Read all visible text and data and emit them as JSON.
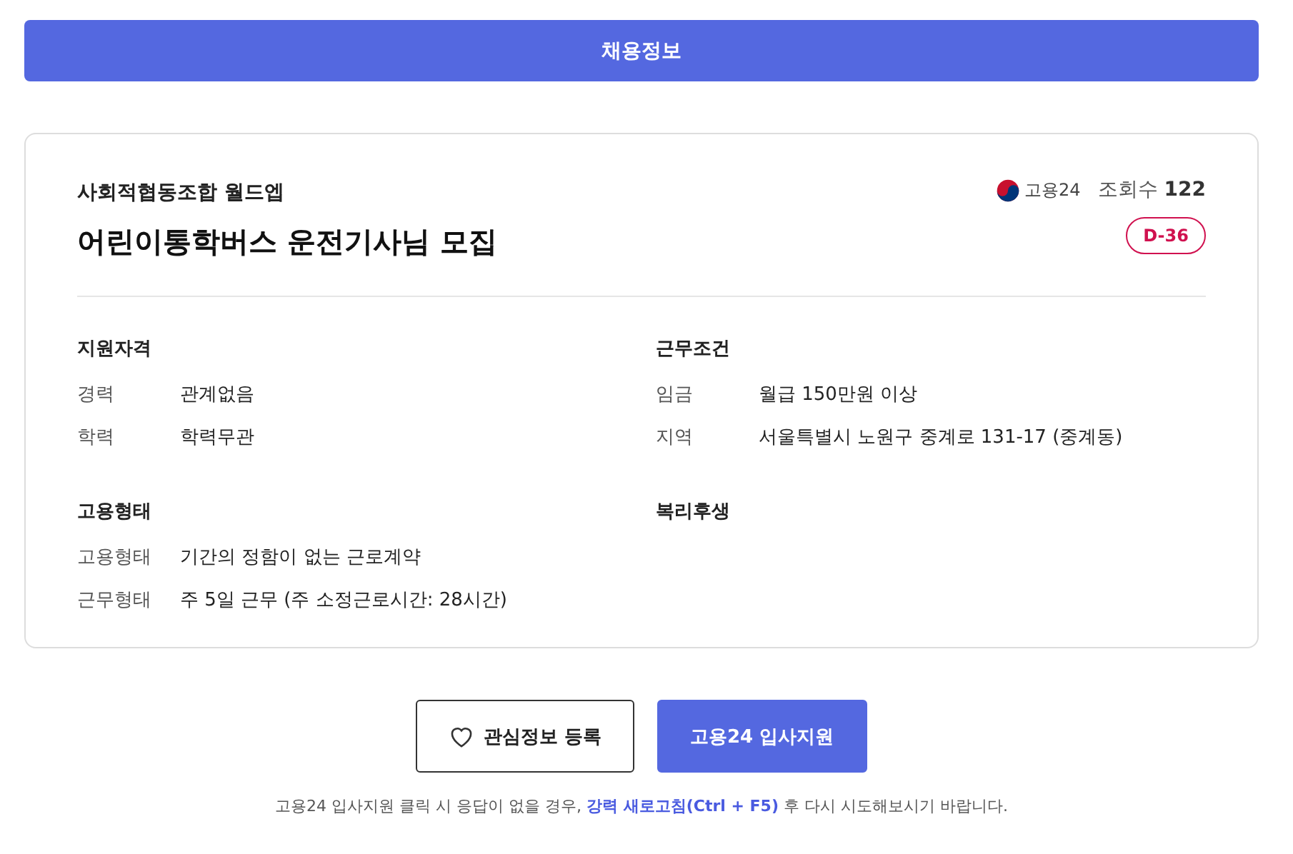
{
  "header": {
    "title": "채용정보"
  },
  "job": {
    "company": "사회적협동조합 월드엡",
    "title": "어린이통학버스 운전기사님 모집",
    "source": "고용24",
    "views": "조회수 **122**",
    "deadline": "D-36"
  },
  "sections": [
    {
      "heading": "지원자격",
      "rows": [
        {
          "label": "경력",
          "value": "관계없음"
        },
        {
          "label": "학력",
          "value": "학력무관"
        }
      ]
    },
    {
      "heading": "근무조건",
      "rows": [
        {
          "label": "임금",
          "value": "월급 150만원 이상"
        },
        {
          "label": "지역",
          "value": "서울특별시 노원구 중계로 131-17 (중계동)"
        }
      ]
    },
    {
      "heading": "고용형태",
      "rows": [
        {
          "label": "고용형태",
          "value": "기간의 정함이 없는 근로계약"
        },
        {
          "label": "근무형태",
          "value": "주 5일 근무 (주 소정근로시간: 28시간)"
        }
      ]
    },
    {
      "heading": "복리후생"
    }
  ],
  "buttons": [
    {
      "label": "관심정보 등록",
      "kind": "outline"
    },
    {
      "label": "고용24 입사지원",
      "kind": "primary"
    }
  ],
  "note": "고용24 입사지원 클릭 시 응답이 없을 경우, **강력 새로고침(Ctrl + F5)** 후 다시 시도해보시기 바랍니다."
}
